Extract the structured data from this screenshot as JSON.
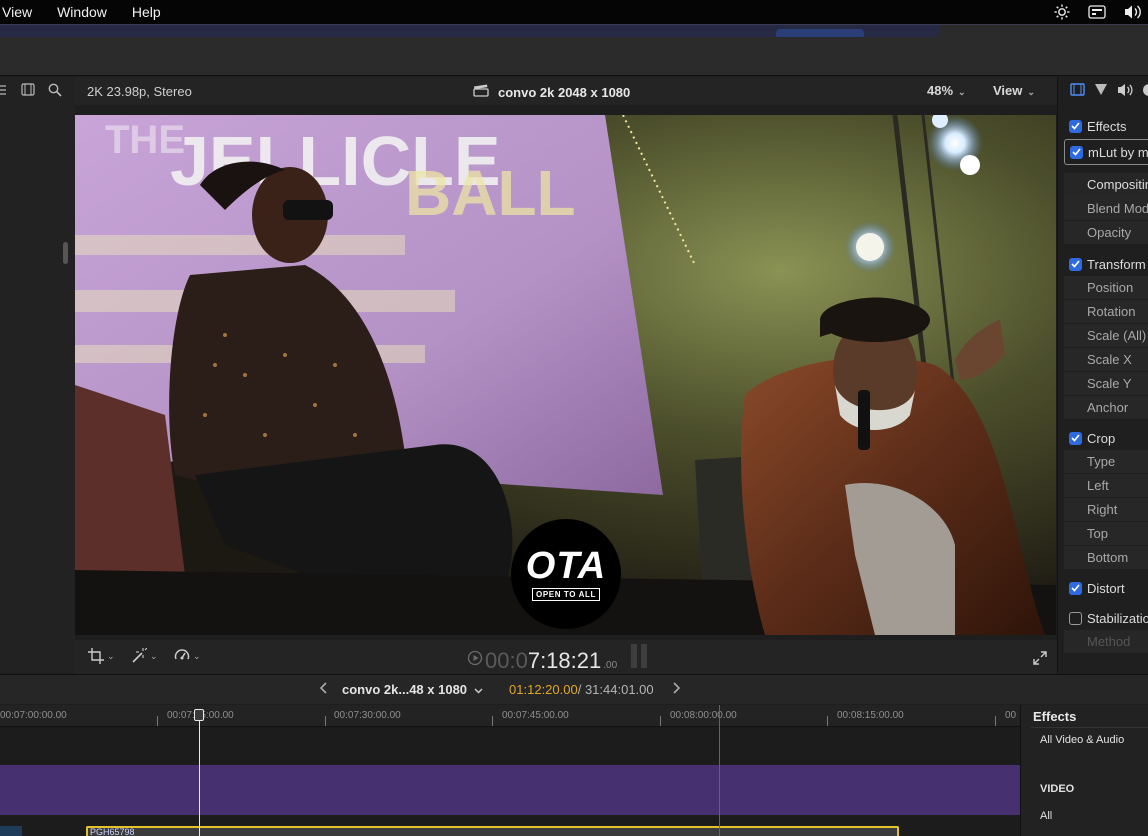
{
  "menubar": {
    "items": [
      "View",
      "Window",
      "Help"
    ]
  },
  "viewer": {
    "format": "2K 23.98p, Stereo",
    "clip_name": "convo 2k 2048 x 1080",
    "zoom": "48%",
    "view_menu": "View",
    "timecode_dim": "00:0",
    "timecode_bright": "7:18:21",
    "timecode_frames": ".00",
    "logo": {
      "main": "OTA",
      "sub": "OPEN TO ALL"
    },
    "backdrop_text": [
      "THE",
      "JELLICLE",
      "BALL"
    ]
  },
  "inspector": {
    "sections": {
      "effects": "Effects",
      "mlut": "mLut by mc",
      "compositing": "Compositing",
      "blend_mode": "Blend Mode",
      "opacity": "Opacity",
      "transform": "Transform",
      "position": "Position",
      "rotation": "Rotation",
      "scale_all": "Scale (All)",
      "scale_x": "Scale X",
      "scale_y": "Scale Y",
      "anchor": "Anchor",
      "crop": "Crop",
      "type": "Type",
      "left": "Left",
      "right": "Right",
      "top": "Top",
      "bottom": "Bottom",
      "distort": "Distort",
      "stabilization": "Stabilization",
      "method": "Method"
    }
  },
  "timeline_header": {
    "project": "convo 2k...48 x 1080",
    "position": "01:12:20.00",
    "duration": "/ 31:44:01.00"
  },
  "timeline": {
    "ruler_labels": [
      "00:07:00:00.00",
      "00:07:15:00.00",
      "00:07:30:00.00",
      "00:07:45:00.00",
      "00:08:00:00.00",
      "00:08:15:00.00",
      "00"
    ],
    "clip_label": "PGH65798"
  },
  "effects_browser": {
    "title": "Effects",
    "item_all_video_audio": "All Video & Audio",
    "category_video": "VIDEO",
    "item_all": "All"
  },
  "colors": {
    "accent_blue": "#2f6be0",
    "timecode_position": "#e0a626",
    "clip_border": "#e3c12b",
    "skimmer": "#d6342c",
    "video_track": "#46306f"
  }
}
